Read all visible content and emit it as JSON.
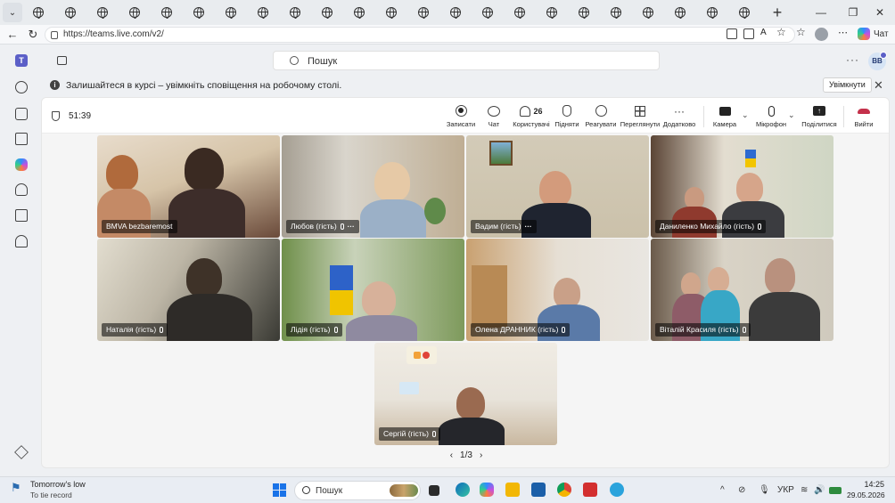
{
  "browser": {
    "tab_count": 23,
    "url": "https://teams.live.com/v2/",
    "chat_label": "Чат"
  },
  "teams": {
    "search_placeholder": "Пошук",
    "user_initials": "BB",
    "notification": {
      "message": "Залишайтеся в курсі – увімкніть сповіщення на робочому столі.",
      "button": "Увімкнути"
    }
  },
  "meeting": {
    "timer": "51:39",
    "toolbar": {
      "record": "Записати",
      "chat": "Чат",
      "people": "Користувачі",
      "people_count": "26",
      "raise": "Підняти",
      "react": "Реагувати",
      "view": "Переглянути",
      "more": "Додатково",
      "camera": "Камера",
      "mic": "Мікрофон",
      "share": "Поділитися",
      "leave": "Вийти"
    },
    "participants": [
      {
        "name": "BMVA bezbaremost",
        "muted": false,
        "more": false
      },
      {
        "name": "Любов (гість)",
        "muted": true,
        "more": true
      },
      {
        "name": "Вадим (гість)",
        "muted": false,
        "more": true
      },
      {
        "name": "Даниленко Михайло (гість)",
        "muted": true,
        "more": false
      },
      {
        "name": "Наталія (гість)",
        "muted": true,
        "more": false
      },
      {
        "name": "Лідія (гість)",
        "muted": true,
        "more": false
      },
      {
        "name": "Олена ДРАННИК (гість)",
        "muted": true,
        "more": false
      },
      {
        "name": "Віталій Красиля (гість)",
        "muted": true,
        "more": false
      },
      {
        "name": "Сергій (гість)",
        "muted": true,
        "more": false
      }
    ],
    "pager": "1/3"
  },
  "taskbar": {
    "weather_title": "Tomorrow's low",
    "weather_sub": "To tie record",
    "search_placeholder": "Пошук",
    "language": "УКР",
    "time": "14:25",
    "date": "29.05.2026"
  }
}
